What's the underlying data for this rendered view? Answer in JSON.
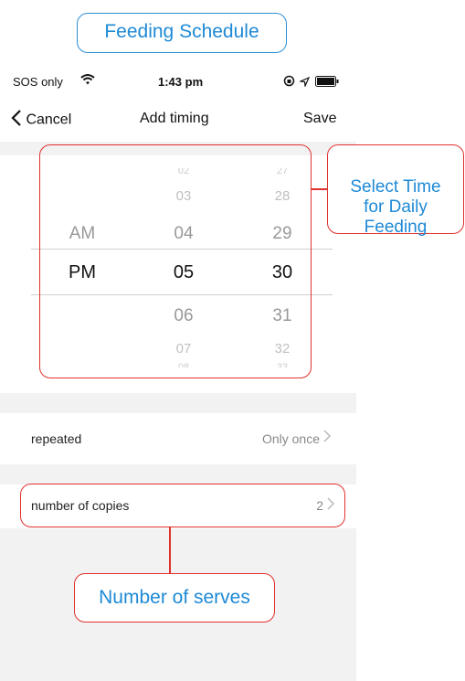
{
  "annotations": {
    "title": "Feeding Schedule",
    "time_note": "Select Time\nfor Daily\nFeeding",
    "serves_note": "Number of serves"
  },
  "status_bar": {
    "carrier": "SOS only",
    "time": "1:43 pm"
  },
  "nav": {
    "cancel": "Cancel",
    "title": "Add timing",
    "save": "Save"
  },
  "picker": {
    "ampm": [
      "AM",
      "PM"
    ],
    "hours": [
      "02",
      "03",
      "04",
      "05",
      "06",
      "07",
      "08"
    ],
    "minutes": [
      "27",
      "28",
      "29",
      "30",
      "31",
      "32",
      "33"
    ],
    "selected": {
      "ampm": "PM",
      "hour": "05",
      "minute": "30"
    }
  },
  "repeated": {
    "label": "repeated",
    "value": "Only once"
  },
  "copies": {
    "label": "number of copies",
    "value": "2"
  },
  "colors": {
    "accent_blue": "#1e8ad6",
    "annotation_red": "#e0312d",
    "gray_bg": "#f2f2f2"
  }
}
